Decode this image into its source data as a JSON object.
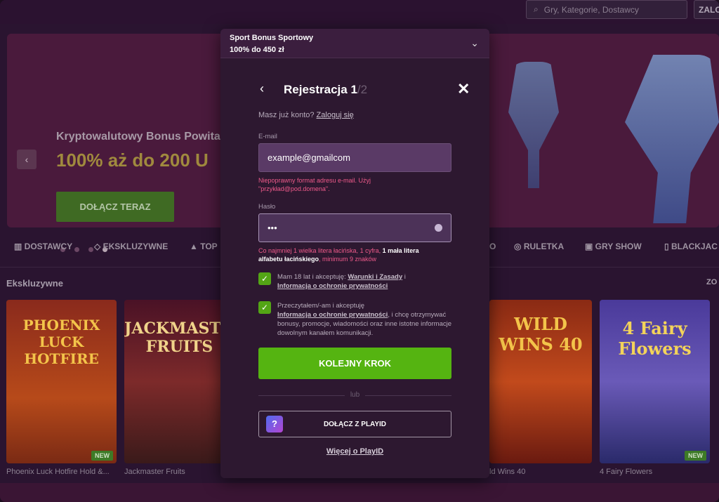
{
  "topbar": {
    "search_placeholder": "Gry, Kategorie, Dostawcy",
    "login_label": "ZALO"
  },
  "banner": {
    "subtitle": "Kryptowalutowy Bonus Powitalny",
    "headline": "100% aż do 200 U",
    "cta": "DOŁĄCZ TERAZ",
    "prev_icon": "chevron-left-icon"
  },
  "categories": [
    "DOSTAWCY",
    "EKSKLUZYWNE",
    "TOP",
    "O",
    "RULETKA",
    "GRY SHOW",
    "BLACKJAC"
  ],
  "section": {
    "title": "Ekskluzywne",
    "more": "ZO"
  },
  "games": [
    {
      "title_art": "PHOENIX LUCK HOTFIRE",
      "label": "Phoenix Luck Hotfire Hold &...",
      "new": "NEW"
    },
    {
      "title_art": "JACKMASTER FRUITS",
      "label": "Jackmaster Fruits",
      "new": ""
    },
    {
      "title_art": "WILD WINS 40",
      "label": "ld Wins 40",
      "new": ""
    },
    {
      "title_art": "4 Fairy Flowers",
      "label": "4 Fairy Flowers",
      "new": "NEW"
    }
  ],
  "modal": {
    "bonus_line1": "Sport Bonus Sportowy",
    "bonus_line2": "100% do 450 zł",
    "title": "Rejestracja 1",
    "step_total": "/2",
    "already_text": "Masz już konto?",
    "login_link": "Zaloguj się",
    "email_label": "E-mail",
    "email_value": "example@gmailcom",
    "email_error": "Niepoprawny format adresu e-mail. Użyj \"przykład@pod.domena\".",
    "password_label": "Hasło",
    "password_value": "•••",
    "pwd_err_1": "Co najmniej 1 wielka litera łacińska, 1 cyfra, ",
    "pwd_err_2": "1 mała litera alfabetu łacińskiego",
    "pwd_err_3": ", minimum 9 znaków",
    "check1_text": "Mam 18 lat i akceptuję: ",
    "check1_link1": "Warunki i Zasady",
    "check1_and": " i ",
    "check1_link2": "Informacja o ochronie prywatności",
    "check2_text": "Przeczytałem/-am i akceptuję ",
    "check2_link": "Informacja o ochronie prywatności",
    "check2_rest": ", i chcę otrzymywać bonusy, promocje, wiadomości oraz inne istotne informacje dowolnym kanałem komunikacji.",
    "next_button": "KOLEJNY KROK",
    "or_text": "lub",
    "playid_button": "DOŁĄCZ Z PLAYID",
    "more_link": "Więcej o PlayID"
  }
}
